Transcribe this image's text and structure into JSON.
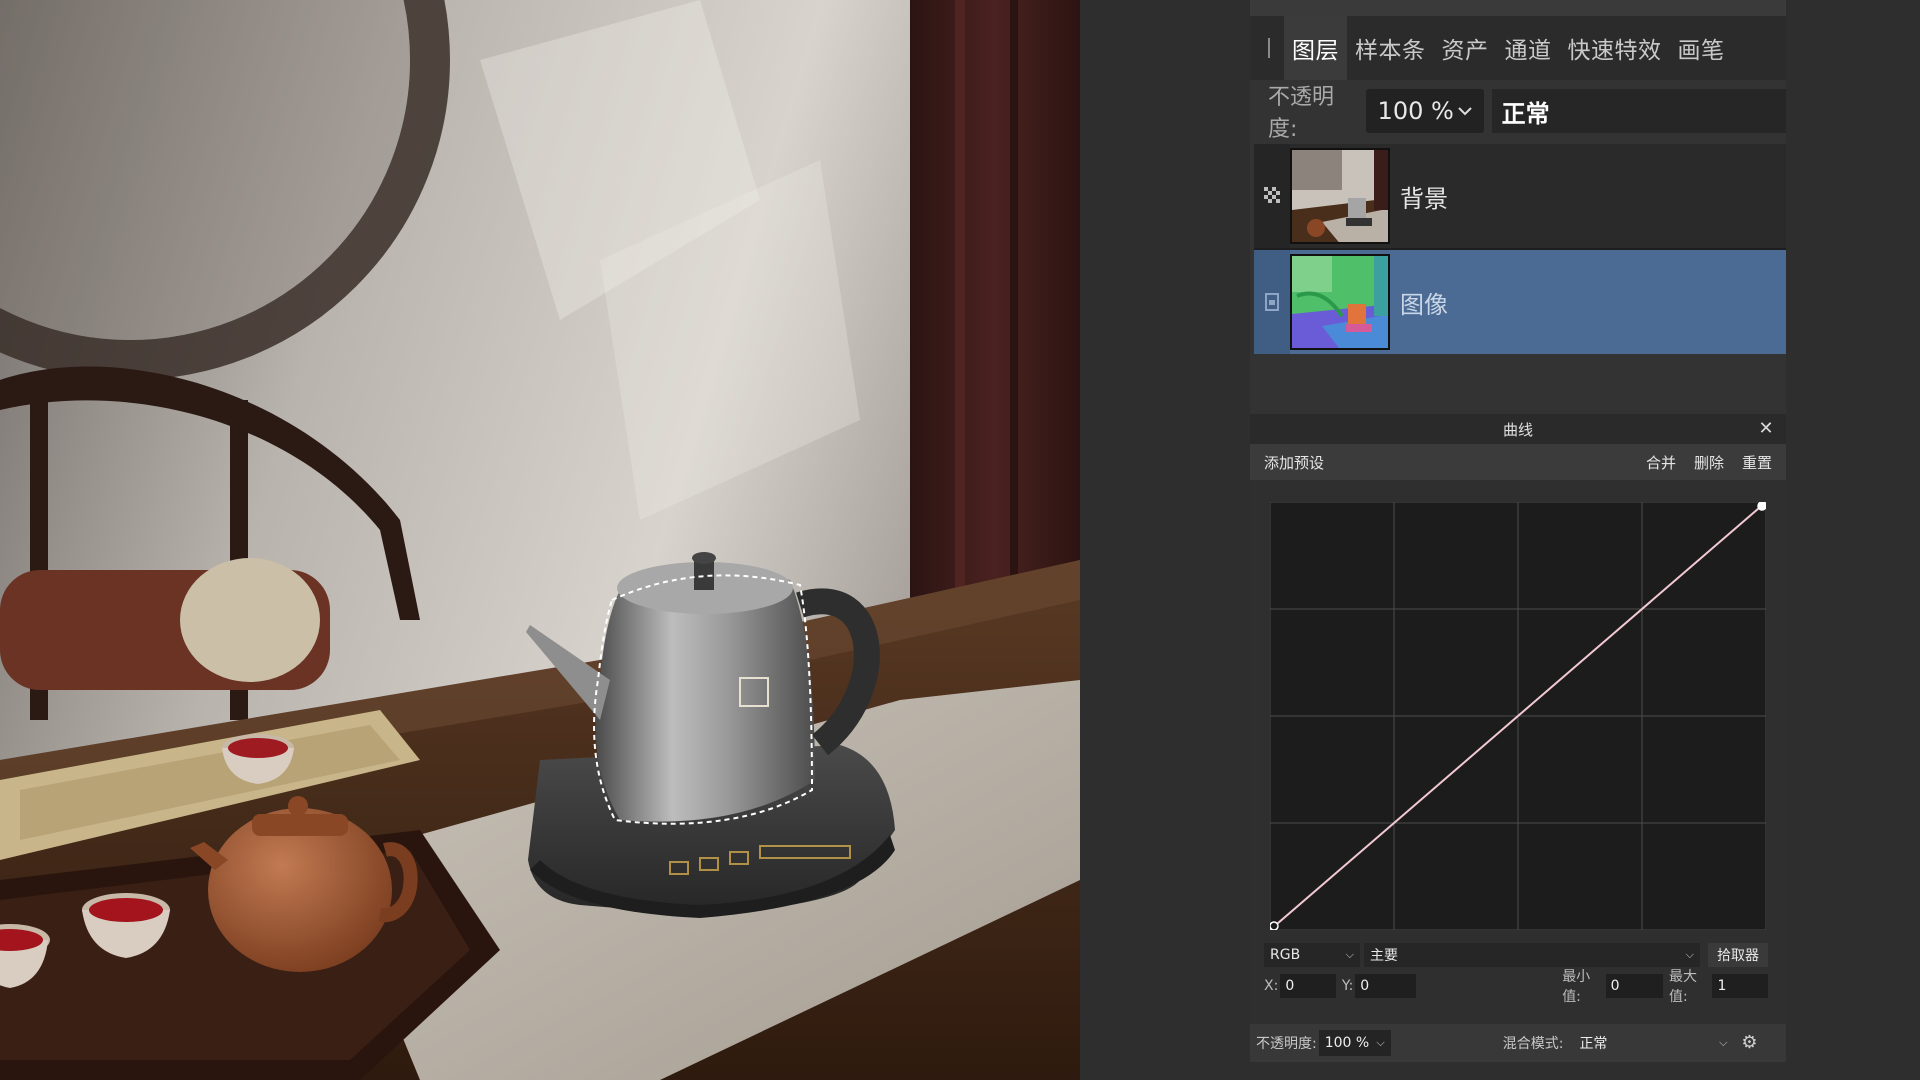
{
  "layers_panel": {
    "tabs": [
      {
        "label": "图层",
        "active": true
      },
      {
        "label": "样本条",
        "active": false
      },
      {
        "label": "资产",
        "active": false
      },
      {
        "label": "通道",
        "active": false
      },
      {
        "label": "快速特效",
        "active": false
      },
      {
        "label": "画笔",
        "active": false
      }
    ],
    "opacity_label": "不透明度:",
    "opacity_value": "100 %",
    "blend_mode": "正常",
    "layers": [
      {
        "name": "背景",
        "selected": false,
        "icon": "transparency-lock-icon"
      },
      {
        "name": "图像",
        "selected": true,
        "icon": "layer-lock-icon"
      }
    ]
  },
  "curves_panel": {
    "title": "曲线",
    "add_preset": "添加预设",
    "merge": "合并",
    "delete": "删除",
    "reset": "重置",
    "channel": "RGB",
    "target": "主要",
    "picker": "拾取器",
    "x_label": "X:",
    "x_value": "0",
    "y_label": "Y:",
    "y_value": "0",
    "min_label": "最小值:",
    "min_value": "0",
    "max_label": "最大值:",
    "max_value": "1",
    "curve_points": [
      [
        0,
        0
      ],
      [
        1,
        1
      ]
    ]
  },
  "bottom_bar": {
    "opacity_label": "不透明度:",
    "opacity_value": "100 %",
    "blend_label": "混合模式:",
    "blend_value": "正常"
  },
  "colors": {
    "selected_layer": "#4b6b95",
    "curve_line": "#f2c9d2"
  }
}
